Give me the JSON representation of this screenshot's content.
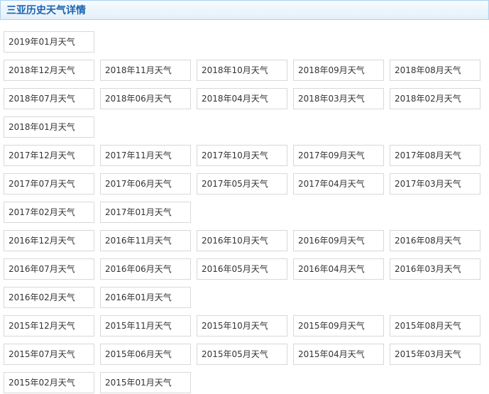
{
  "header": {
    "title": "三亚历史天气详情"
  },
  "rows": [
    [
      "2019年01月天气"
    ],
    [
      "2018年12月天气",
      "2018年11月天气",
      "2018年10月天气",
      "2018年09月天气",
      "2018年08月天气"
    ],
    [
      "2018年07月天气",
      "2018年06月天气",
      "2018年04月天气",
      "2018年03月天气",
      "2018年02月天气"
    ],
    [
      "2018年01月天气"
    ],
    [
      "2017年12月天气",
      "2017年11月天气",
      "2017年10月天气",
      "2017年09月天气",
      "2017年08月天气"
    ],
    [
      "2017年07月天气",
      "2017年06月天气",
      "2017年05月天气",
      "2017年04月天气",
      "2017年03月天气"
    ],
    [
      "2017年02月天气",
      "2017年01月天气"
    ],
    [
      "2016年12月天气",
      "2016年11月天气",
      "2016年10月天气",
      "2016年09月天气",
      "2016年08月天气"
    ],
    [
      "2016年07月天气",
      "2016年06月天气",
      "2016年05月天气",
      "2016年04月天气",
      "2016年03月天气"
    ],
    [
      "2016年02月天气",
      "2016年01月天气"
    ],
    [
      "2015年12月天气",
      "2015年11月天气",
      "2015年10月天气",
      "2015年09月天气",
      "2015年08月天气"
    ],
    [
      "2015年07月天气",
      "2015年06月天气",
      "2015年05月天气",
      "2015年04月天气",
      "2015年03月天气"
    ],
    [
      "2015年02月天气",
      "2015年01月天气"
    ]
  ]
}
